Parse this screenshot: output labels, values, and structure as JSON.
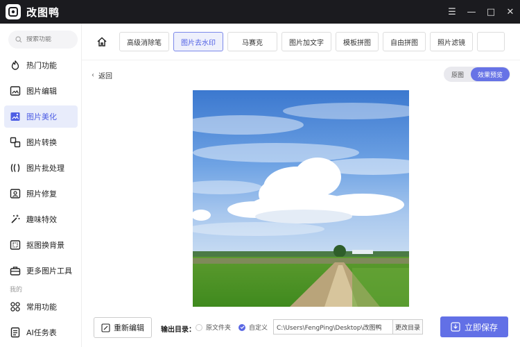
{
  "app": {
    "title": "改图鸭"
  },
  "window": {
    "controls": [
      "☰",
      "—",
      "□",
      "✕"
    ]
  },
  "sidebar": {
    "search_placeholder": "搜索功能",
    "items": [
      {
        "label": "热门功能",
        "icon": "flame-icon",
        "active": false
      },
      {
        "label": "图片编辑",
        "icon": "image-edit-icon",
        "active": false
      },
      {
        "label": "图片美化",
        "icon": "image-beautify-icon",
        "active": true
      },
      {
        "label": "图片转换",
        "icon": "convert-icon",
        "active": false
      },
      {
        "label": "图片批处理",
        "icon": "batch-icon",
        "active": false
      },
      {
        "label": "照片修复",
        "icon": "photo-repair-icon",
        "active": false
      },
      {
        "label": "趣味特效",
        "icon": "magic-wand-icon",
        "active": false
      },
      {
        "label": "抠图换背景",
        "icon": "cutout-icon",
        "active": false
      },
      {
        "label": "更多图片工具",
        "icon": "toolbox-icon",
        "active": false
      }
    ],
    "section_label": "我的",
    "my_items": [
      {
        "label": "常用功能",
        "icon": "grid-icon"
      },
      {
        "label": "AI任务表",
        "icon": "task-list-icon"
      }
    ]
  },
  "toolbar": {
    "tools": [
      {
        "label": "高级消除笔",
        "active": false
      },
      {
        "label": "图片去水印",
        "active": true
      },
      {
        "label": "马赛克",
        "active": false
      },
      {
        "label": "图片加文字",
        "active": false
      },
      {
        "label": "模板拼图",
        "active": false
      },
      {
        "label": "自由拼图",
        "active": false
      },
      {
        "label": "照片滤镜",
        "active": false
      }
    ]
  },
  "main": {
    "back_label": "返回",
    "toggle": {
      "original": "原图",
      "preview": "效果预览",
      "selected": "preview"
    }
  },
  "bottom": {
    "reedit_label": "重新编辑",
    "output_label": "输出目录：",
    "option_original": "原文件夹",
    "option_custom": "自定义",
    "selected_option": "custom",
    "path": "C:\\Users\\FengPing\\Desktop\\改图鸭",
    "change_dir_label": "更改目录",
    "save_label": "立即保存"
  },
  "colors": {
    "accent": "#6270e6",
    "titlebar": "#1b1b1f",
    "active_bg": "#e8ecfb"
  }
}
